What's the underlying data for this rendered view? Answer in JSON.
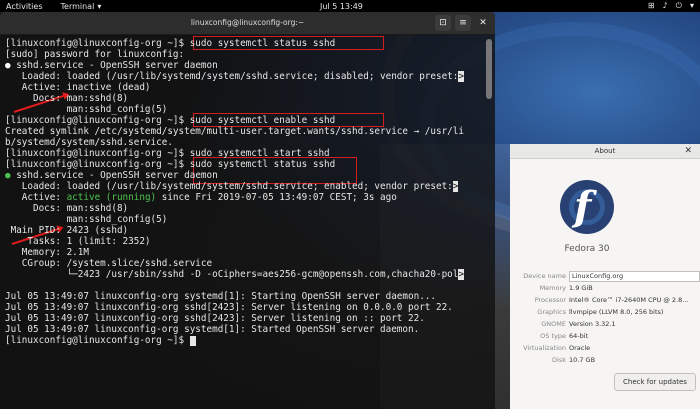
{
  "topbar": {
    "activities": "Activities",
    "app": "Terminal",
    "app_caret": "▾",
    "clock": "Jul 5  13:49",
    "tray": [
      "⊞",
      "♪",
      "⏻",
      "▾"
    ]
  },
  "terminal": {
    "title": "linuxconfig@linuxconfig-org:~",
    "buttons": [
      "⊡",
      "≡",
      "✕"
    ],
    "lines": [
      "[linuxconfig@linuxconfig-org ~]$ sudo systemctl status sshd",
      "[sudo] password for linuxconfig:",
      "● sshd.service - OpenSSH server daemon",
      "   Loaded: loaded (/usr/lib/systemd/system/sshd.service; disabled; vendor preset:",
      "   Active: inactive (dead)",
      "     Docs: man:sshd(8)",
      "           man:sshd_config(5)",
      "[linuxconfig@linuxconfig-org ~]$ sudo systemctl enable sshd",
      "Created symlink /etc/systemd/system/multi-user.target.wants/sshd.service → /usr/li",
      "b/systemd/system/sshd.service.",
      "[linuxconfig@linuxconfig-org ~]$ sudo systemctl start sshd",
      "[linuxconfig@linuxconfig-org ~]$ sudo systemctl status sshd",
      "● sshd.service - OpenSSH server daemon",
      "   Loaded: loaded (/usr/lib/systemd/system/sshd.service; enabled; vendor preset:",
      "   Active: ",
      "     Docs: man:sshd(8)",
      "           man:sshd_config(5)",
      " Main PID: 2423 (sshd)",
      "    Tasks: 1 (limit: 2352)",
      "   Memory: 2.1M",
      "   CGroup: /system.slice/sshd.service",
      "           └─2423 /usr/sbin/sshd -D -oCiphers=aes256-gcm@openssh.com,chacha20-pol",
      "",
      "Jul 05 13:49:07 linuxconfig-org systemd[1]: Starting OpenSSH server daemon...",
      "Jul 05 13:49:07 linuxconfig-org sshd[2423]: Server listening on 0.0.0.0 port 22.",
      "Jul 05 13:49:07 linuxconfig-org sshd[2423]: Server listening on :: port 22.",
      "Jul 05 13:49:07 linuxconfig-org systemd[1]: Started OpenSSH server daemon.",
      "[linuxconfig@linuxconfig-org ~]$ "
    ],
    "active_running": "active (running)",
    "active_rest": " since Fri 2019-07-05 13:49:07 CEST; 3s ago",
    "overflow_marks": [
      ">",
      ">",
      ">"
    ],
    "highlight_color": "#d41d1d",
    "running_color": "#4ec24e"
  },
  "about": {
    "title": "About",
    "close": "✕",
    "os_name": "Fedora 30",
    "device_name_label": "Device name",
    "device_name_value": "LinuxConfig.org",
    "rows": [
      {
        "k": "Memory",
        "v": "1.9 GiB"
      },
      {
        "k": "Processor",
        "v": "Intel® Core™ i7-2640M CPU @ 2.8..."
      },
      {
        "k": "Graphics",
        "v": "llvmpipe (LLVM 8.0, 256 bits)"
      },
      {
        "k": "GNOME",
        "v": "Version 3.32.1"
      },
      {
        "k": "OS type",
        "v": "64-bit"
      },
      {
        "k": "Virtualization",
        "v": "Oracle"
      },
      {
        "k": "Disk",
        "v": "10.7 GB"
      }
    ],
    "check_updates": "Check for updates",
    "logo_letter": "f"
  }
}
